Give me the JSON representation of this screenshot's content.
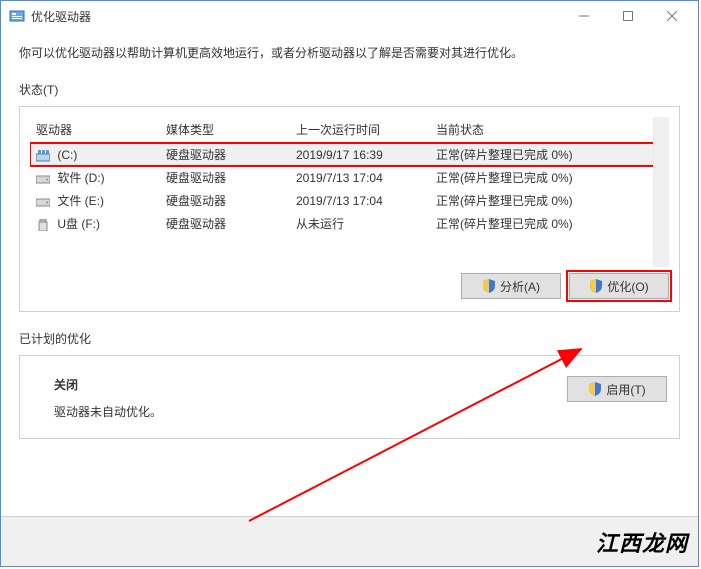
{
  "window": {
    "title": "优化驱动器"
  },
  "intro": "你可以优化驱动器以帮助计算机更高效地运行，或者分析驱动器以了解是否需要对其进行优化。",
  "status_label": "状态(T)",
  "columns": {
    "drive": "驱动器",
    "media": "媒体类型",
    "lastrun": "上一次运行时间",
    "status": "当前状态"
  },
  "rows": [
    {
      "name": "(C:)",
      "media": "硬盘驱动器",
      "lastrun": "2019/9/17 16:39",
      "status": "正常(碎片整理已完成 0%)",
      "icon": "system"
    },
    {
      "name": "软件 (D:)",
      "media": "硬盘驱动器",
      "lastrun": "2019/7/13 17:04",
      "status": "正常(碎片整理已完成 0%)",
      "icon": "hdd"
    },
    {
      "name": "文件 (E:)",
      "media": "硬盘驱动器",
      "lastrun": "2019/7/13 17:04",
      "status": "正常(碎片整理已完成 0%)",
      "icon": "hdd"
    },
    {
      "name": "U盘 (F:)",
      "media": "硬盘驱动器",
      "lastrun": "从未运行",
      "status": "正常(碎片整理已完成 0%)",
      "icon": "usb"
    }
  ],
  "buttons": {
    "analyze": "分析(A)",
    "optimize": "优化(O)",
    "enable": "启用(T)"
  },
  "scheduled": {
    "label": "已计划的优化",
    "title": "关闭",
    "sub": "驱动器未自动优化。"
  },
  "watermark": "江西龙网"
}
